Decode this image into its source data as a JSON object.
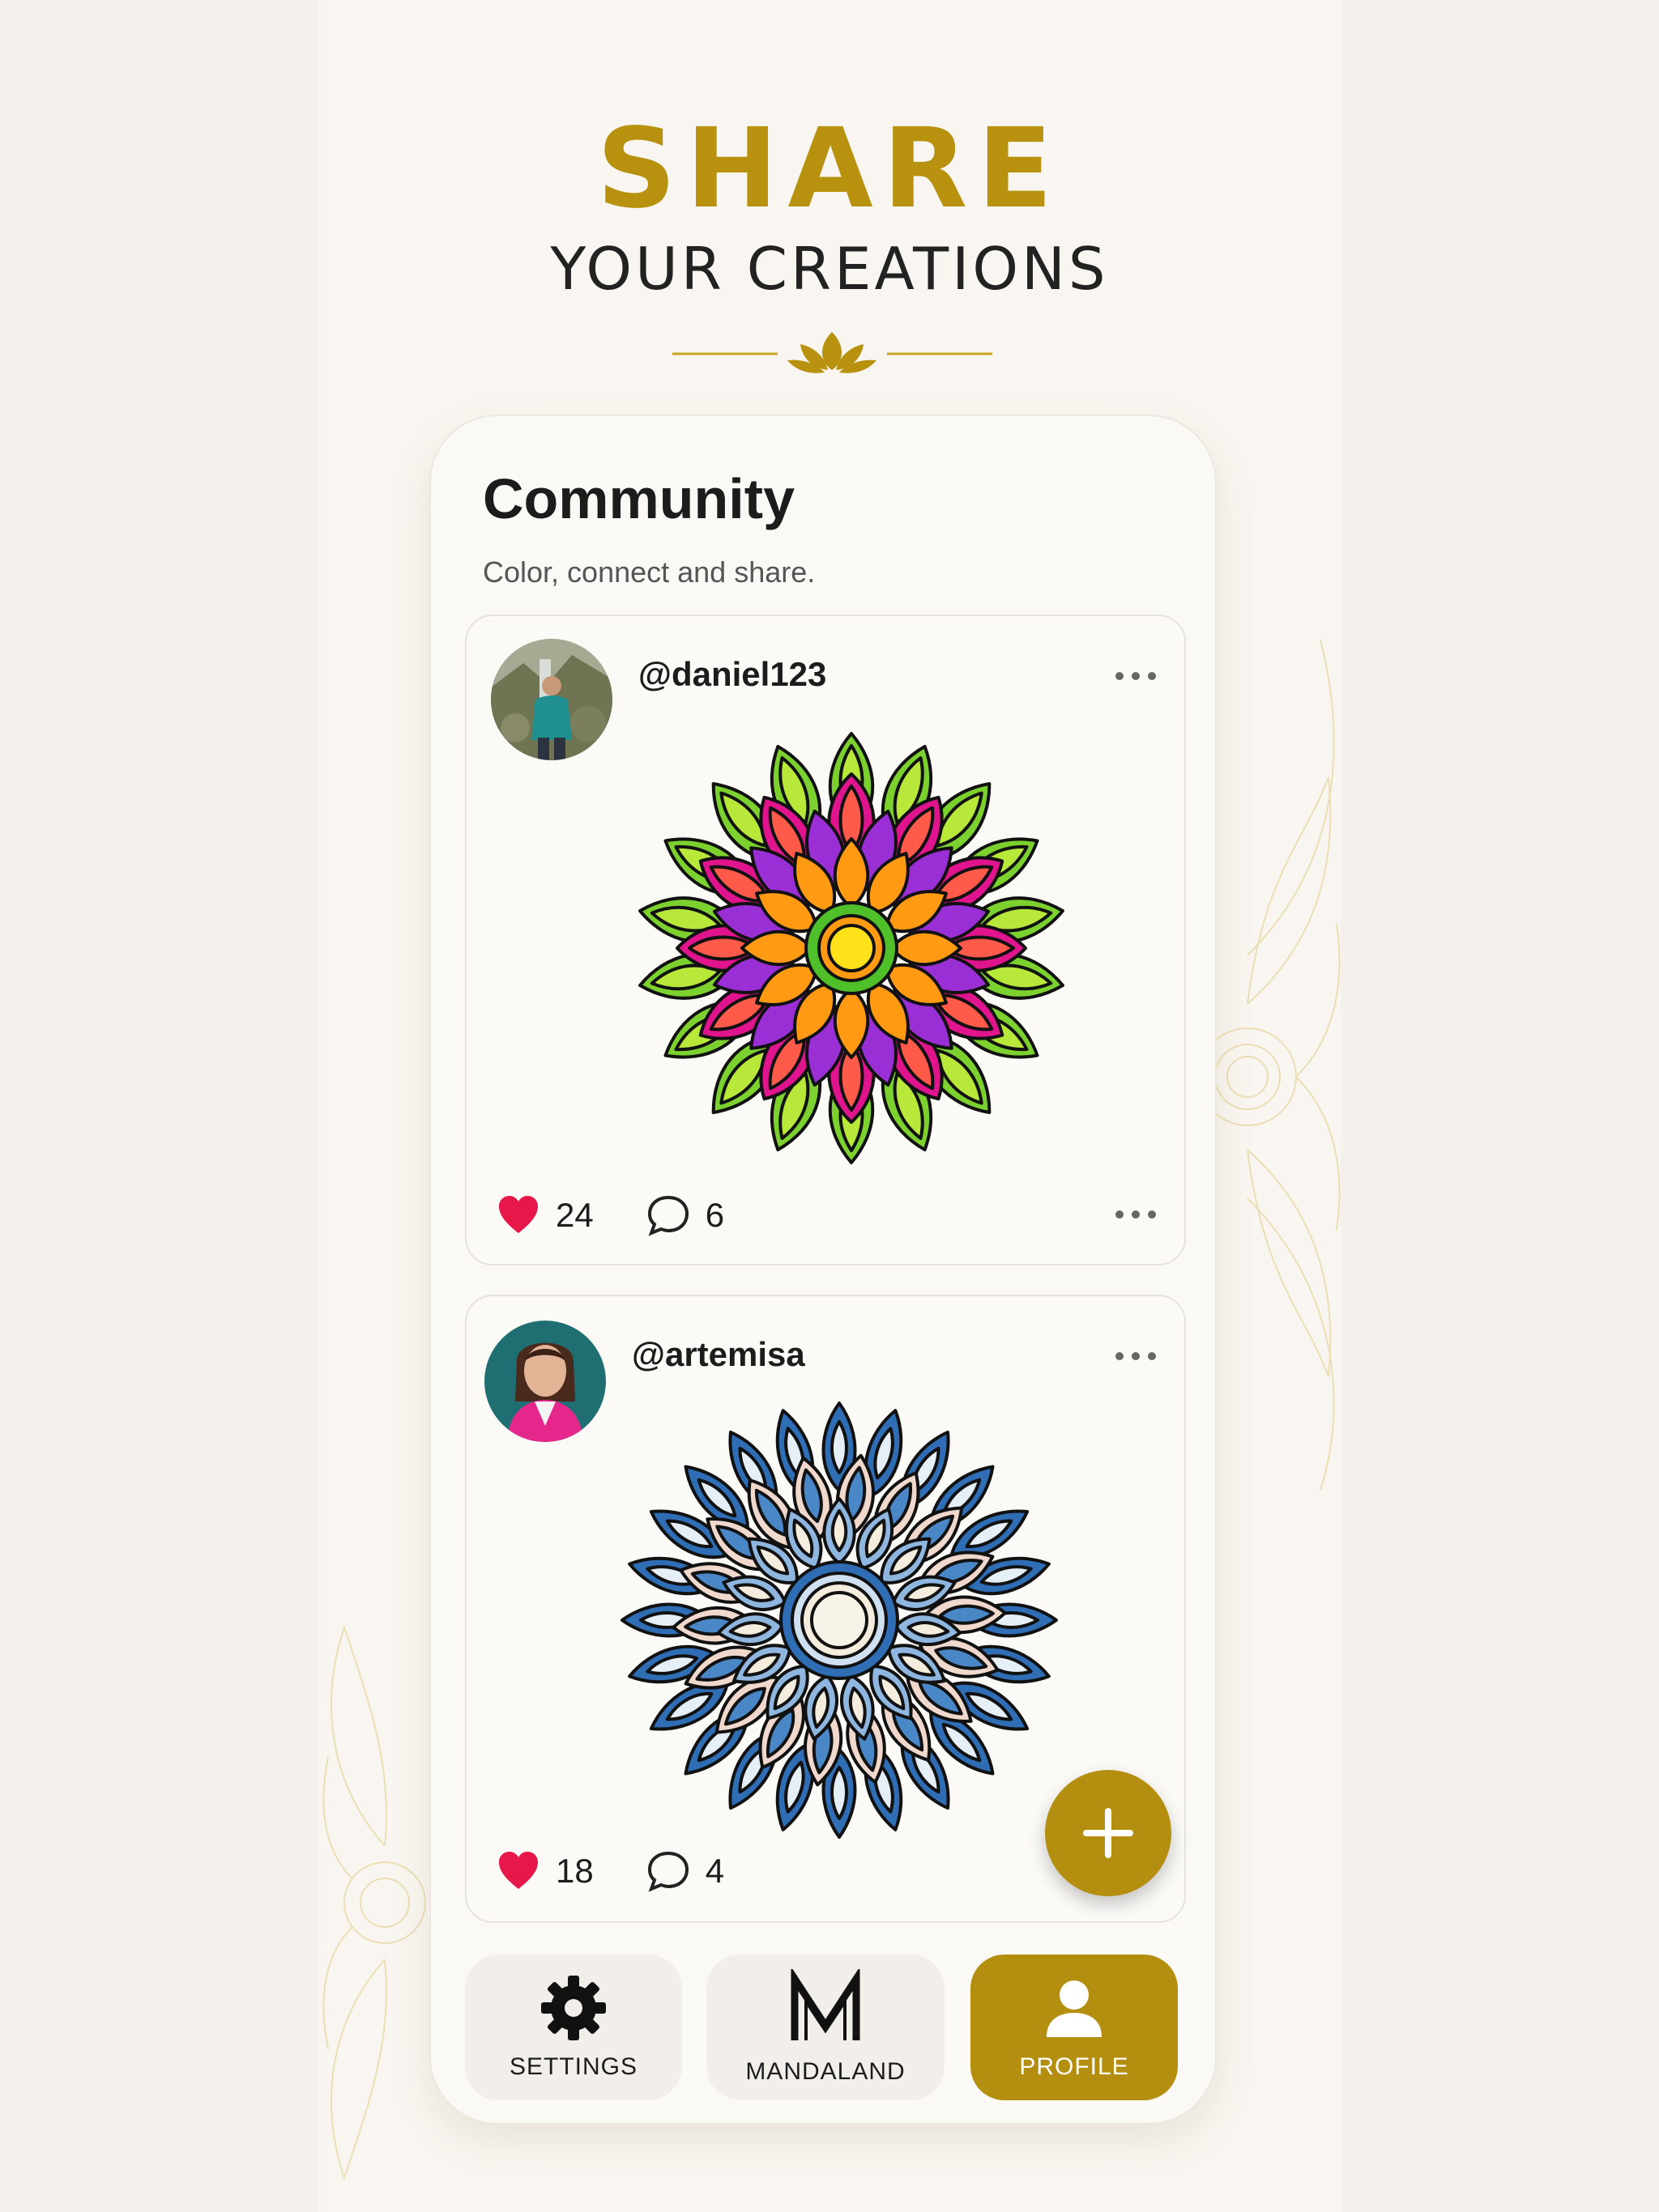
{
  "hero": {
    "title": "SHARE",
    "subtitle": "YOUR CREATIONS"
  },
  "community": {
    "title": "Community",
    "subtitle": "Color, connect and share."
  },
  "posts": [
    {
      "username": "@daniel123",
      "likes": "24",
      "comments": "6",
      "avatar": "man-outdoor-avatar",
      "artwork": "colorful-rainbow-mandala"
    },
    {
      "username": "@artemisa",
      "likes": "18",
      "comments": "4",
      "avatar": "woman-teal-background-avatar",
      "artwork": "blue-mandala"
    }
  ],
  "nav": {
    "settings": "SETTINGS",
    "mandaland": "MANDALAND",
    "mandaland_logo": "M",
    "profile": "PROFILE"
  },
  "colors": {
    "gold": "#b8920e",
    "like": "#e8174a",
    "accent_button": "#b38e0f"
  }
}
